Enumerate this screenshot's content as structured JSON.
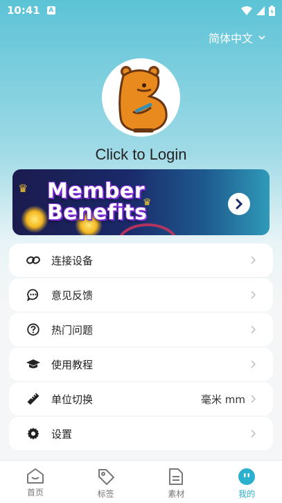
{
  "status": {
    "time": "10:41",
    "notif": "A"
  },
  "language": {
    "label": "简体中文"
  },
  "profile": {
    "login_text": "Click to Login"
  },
  "banner": {
    "title_line1": "Member",
    "title_line2": "Benefits"
  },
  "menu": [
    {
      "label": "连接设备",
      "value": ""
    },
    {
      "label": "意见反馈",
      "value": ""
    },
    {
      "label": "热门问题",
      "value": ""
    },
    {
      "label": "使用教程",
      "value": ""
    },
    {
      "label": "单位切换",
      "value": "毫米 mm"
    },
    {
      "label": "设置",
      "value": ""
    }
  ],
  "tabs": [
    {
      "label": "首页",
      "icon": "home-icon"
    },
    {
      "label": "标签",
      "icon": "tag-icon"
    },
    {
      "label": "素材",
      "icon": "document-icon"
    },
    {
      "label": "我的",
      "icon": "profile-icon",
      "active": true
    }
  ],
  "colors": {
    "accent": "#2bb0cd",
    "header": "#5cc3d6"
  }
}
